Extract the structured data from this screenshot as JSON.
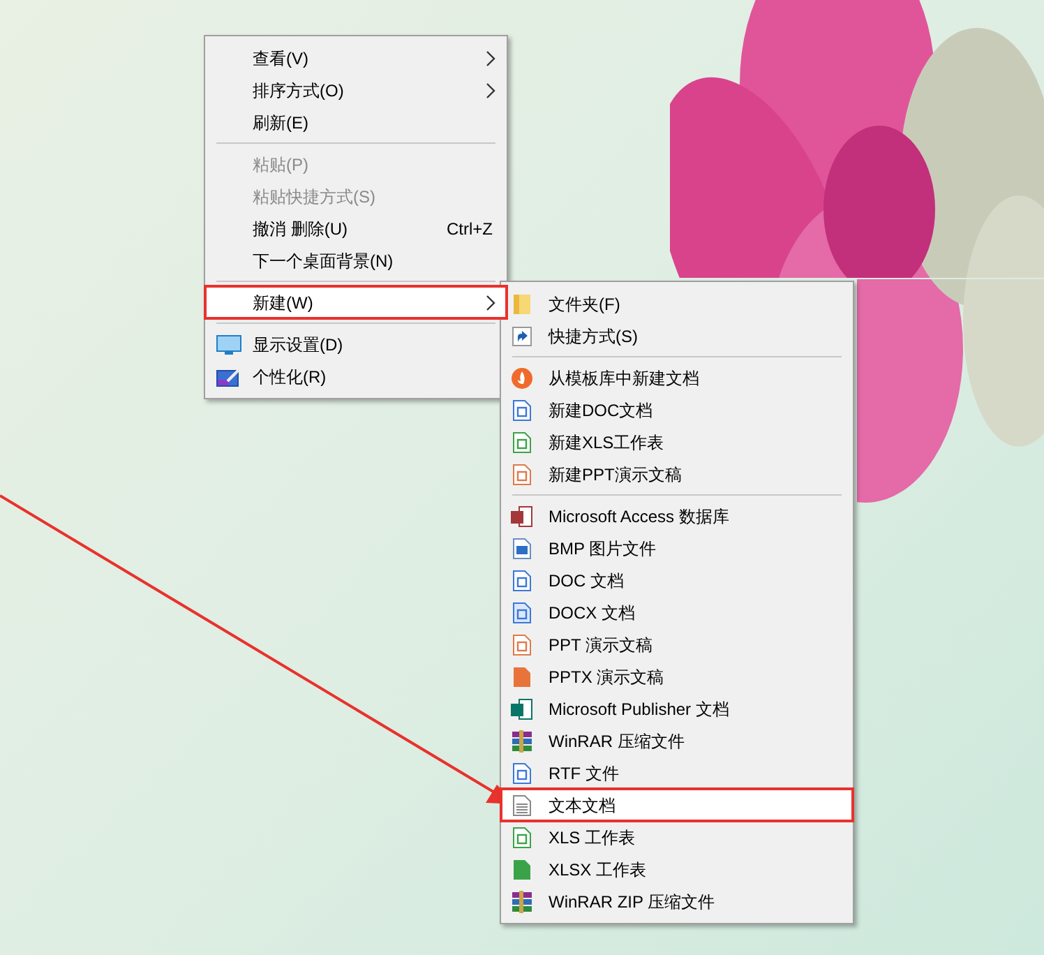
{
  "context_menu": {
    "items": [
      {
        "kind": "submenu",
        "label": "查看(V)",
        "disabled": false,
        "selected": false
      },
      {
        "kind": "submenu",
        "label": "排序方式(O)",
        "disabled": false,
        "selected": false
      },
      {
        "kind": "plain",
        "label": "刷新(E)",
        "disabled": false,
        "selected": false
      },
      {
        "kind": "separator"
      },
      {
        "kind": "plain",
        "label": "粘贴(P)",
        "disabled": true,
        "selected": false
      },
      {
        "kind": "plain",
        "label": "粘贴快捷方式(S)",
        "disabled": true,
        "selected": false
      },
      {
        "kind": "plain",
        "label": "撤消 删除(U)",
        "shortcut": "Ctrl+Z",
        "disabled": false,
        "selected": false
      },
      {
        "kind": "plain",
        "label": "下一个桌面背景(N)",
        "disabled": false,
        "selected": false
      },
      {
        "kind": "separator"
      },
      {
        "kind": "submenu",
        "label": "新建(W)",
        "disabled": false,
        "selected": true
      },
      {
        "kind": "separator"
      },
      {
        "kind": "display",
        "label": "显示设置(D)",
        "disabled": false,
        "selected": false
      },
      {
        "kind": "personalize",
        "label": "个性化(R)",
        "disabled": false,
        "selected": false
      }
    ]
  },
  "new_submenu": {
    "items": [
      {
        "kind": "folder",
        "label": "文件夹(F)",
        "selected": false
      },
      {
        "kind": "shortcut",
        "label": "快捷方式(S)",
        "selected": false
      },
      {
        "kind": "separator"
      },
      {
        "kind": "template",
        "label": "从模板库中新建文档",
        "selected": false
      },
      {
        "kind": "doc",
        "label": "新建DOC文档",
        "selected": false
      },
      {
        "kind": "xls",
        "label": "新建XLS工作表",
        "selected": false
      },
      {
        "kind": "ppt",
        "label": "新建PPT演示文稿",
        "selected": false
      },
      {
        "kind": "separator"
      },
      {
        "kind": "access",
        "label": "Microsoft Access 数据库",
        "selected": false
      },
      {
        "kind": "bmp",
        "label": "BMP 图片文件",
        "selected": false
      },
      {
        "kind": "doc",
        "label": "DOC 文档",
        "selected": false
      },
      {
        "kind": "docx",
        "label": "DOCX 文档",
        "selected": false
      },
      {
        "kind": "ppt",
        "label": "PPT 演示文稿",
        "selected": false
      },
      {
        "kind": "pptx",
        "label": "PPTX 演示文稿",
        "selected": false
      },
      {
        "kind": "publisher",
        "label": "Microsoft Publisher 文档",
        "selected": false
      },
      {
        "kind": "rar",
        "label": "WinRAR 压缩文件",
        "selected": false
      },
      {
        "kind": "doc",
        "label": "RTF 文件",
        "selected": false
      },
      {
        "kind": "txt",
        "label": "文本文档",
        "selected": true
      },
      {
        "kind": "xls",
        "label": "XLS 工作表",
        "selected": false
      },
      {
        "kind": "xlsx",
        "label": "XLSX 工作表",
        "selected": false
      },
      {
        "kind": "rar",
        "label": "WinRAR ZIP 压缩文件",
        "selected": false
      }
    ]
  }
}
